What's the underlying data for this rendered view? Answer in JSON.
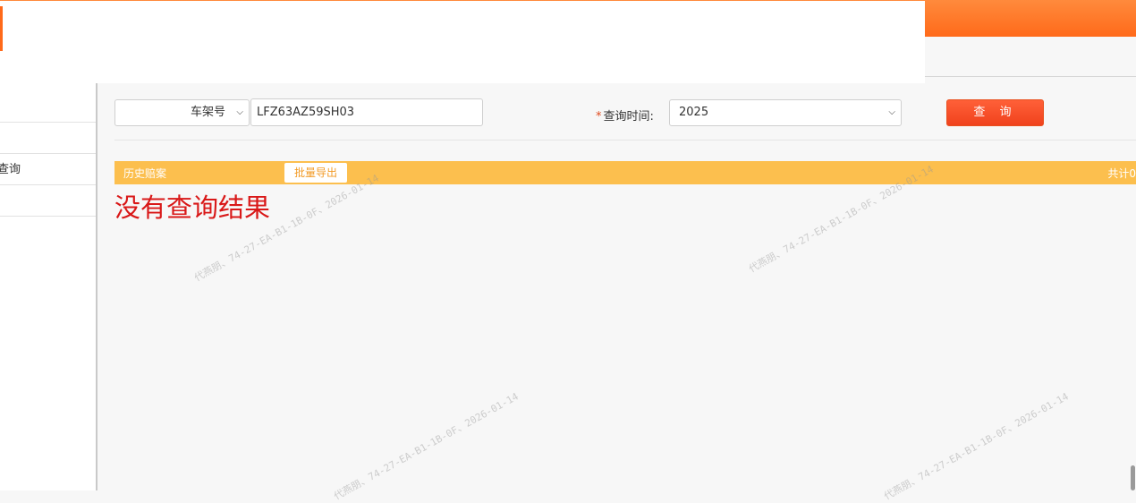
{
  "sidebar": {
    "items": [
      {
        "label": ""
      },
      {
        "label": ""
      },
      {
        "label": "查询"
      },
      {
        "label": ""
      }
    ]
  },
  "search": {
    "field_type": "车架号",
    "vin_value": "LFZ63AZ59SH03",
    "time_required_mark": "*",
    "time_label": "查询时间:",
    "year_value": "2025",
    "query_button": "查 询"
  },
  "results": {
    "title": "历史赔案",
    "export_button": "批量导出",
    "total_label": "共计0",
    "empty_message": "没有查询结果"
  },
  "watermark": {
    "text": "代燕朋、74-27-EA-B1-1B-0F、2026-01-14"
  },
  "colors": {
    "topbar": "#ff7a2a",
    "query_button": "#f24f24",
    "result_bar": "#fcbf4e",
    "empty_message": "#d91818"
  }
}
